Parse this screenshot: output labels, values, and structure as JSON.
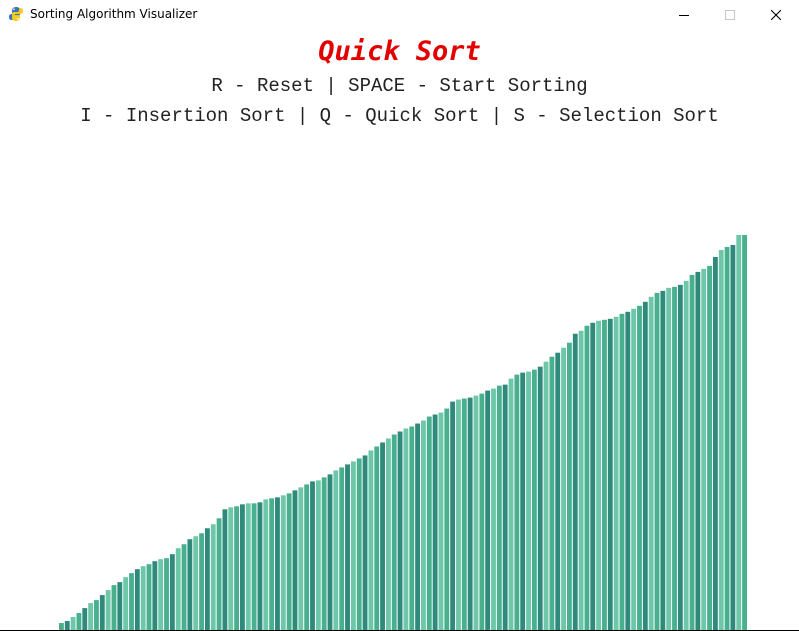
{
  "window": {
    "title": "Sorting Algorithm Visualizer",
    "icon": "pygame-snake-icon"
  },
  "header": {
    "algorithm_title": "Quick Sort",
    "controls_line1": "R - Reset | SPACE - Start Sorting",
    "controls_line2": "I - Insertion Sort | Q - Quick Sort | S - Selection Sort"
  },
  "colors": {
    "title": "#e20000",
    "text": "#222222",
    "bar_shades": [
      "#48b08f",
      "#2f8a7b",
      "#6ec7a8"
    ]
  },
  "chart_data": {
    "type": "bar",
    "order": "ascending",
    "count": 116,
    "value_range": [
      5,
      397
    ],
    "values": [
      7,
      9,
      13,
      17,
      22,
      27,
      30,
      35,
      40,
      45,
      48,
      53,
      57,
      61,
      64,
      66,
      69,
      71,
      72,
      76,
      82,
      86,
      91,
      94,
      97,
      102,
      106,
      112,
      121,
      123,
      124,
      126,
      127,
      127,
      128,
      131,
      132,
      133,
      135,
      137,
      140,
      143,
      146,
      149,
      150,
      153,
      156,
      160,
      163,
      166,
      169,
      172,
      175,
      180,
      184,
      188,
      192,
      196,
      199,
      202,
      204,
      207,
      210,
      214,
      216,
      218,
      222,
      229,
      231,
      232,
      233,
      235,
      237,
      240,
      242,
      245,
      246,
      252,
      256,
      258,
      259,
      261,
      264,
      269,
      274,
      278,
      283,
      288,
      297,
      300,
      305,
      308,
      310,
      311,
      312,
      314,
      317,
      319,
      322,
      325,
      329,
      334,
      338,
      340,
      343,
      344,
      346,
      350,
      356,
      359,
      362,
      365,
      374,
      381,
      384,
      386,
      396,
      396
    ]
  }
}
